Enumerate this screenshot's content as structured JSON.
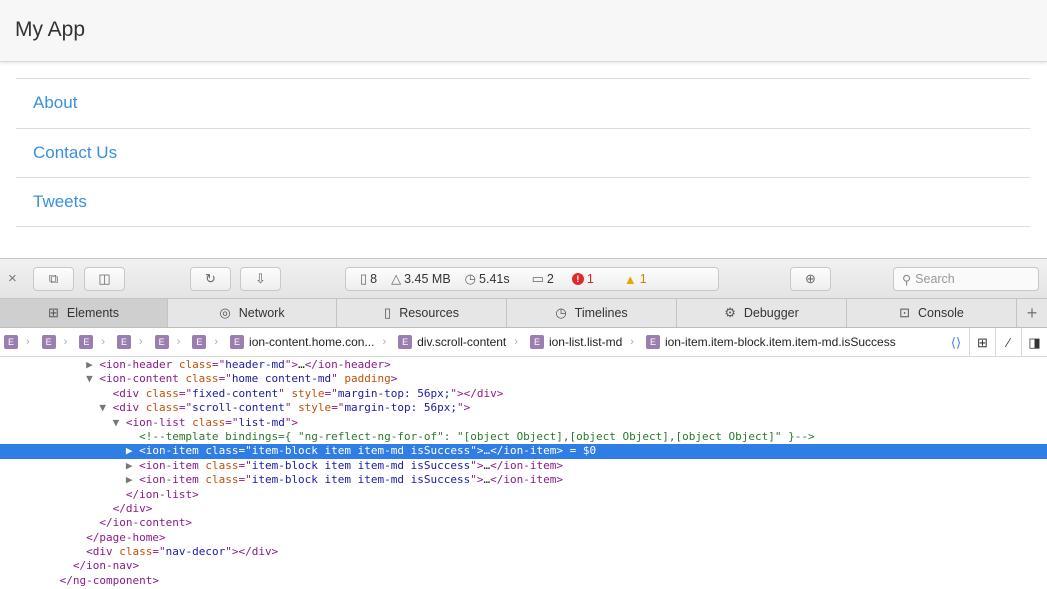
{
  "app": {
    "title": "My App",
    "items": [
      "About",
      "Contact Us",
      "Tweets"
    ]
  },
  "devtools": {
    "toolbar": {
      "close": "×",
      "resources_count": "8",
      "memory": "3.45 MB",
      "time": "5.41s",
      "logs_count": "2",
      "errors_count": "1",
      "warnings_count": "1",
      "search_placeholder": "Search"
    },
    "tabs": [
      {
        "label": "Elements",
        "icon": "elements-icon"
      },
      {
        "label": "Network",
        "icon": "network-icon"
      },
      {
        "label": "Resources",
        "icon": "resources-icon"
      },
      {
        "label": "Timelines",
        "icon": "timelines-icon"
      },
      {
        "label": "Debugger",
        "icon": "debugger-icon"
      },
      {
        "label": "Console",
        "icon": "console-icon"
      }
    ],
    "breadcrumb": {
      "badge": "E",
      "items": [
        "ion-content.home.con...",
        "div.scroll-content",
        "ion-list.list-md",
        "ion-item.item-block.item.item-md.isSuccess"
      ]
    },
    "dom_lines": [
      {
        "indent": 13,
        "tri": "▶ ",
        "parts": [
          [
            "tg",
            "<ion-header "
          ],
          [
            "an",
            "class"
          ],
          [
            "tg",
            "=\""
          ],
          [
            "av",
            "header-md"
          ],
          [
            "tg",
            "\">"
          ],
          [
            "tx",
            "…"
          ],
          [
            "tg",
            "</ion-header>"
          ]
        ]
      },
      {
        "indent": 13,
        "tri": "▼ ",
        "parts": [
          [
            "tg",
            "<ion-content "
          ],
          [
            "an",
            "class"
          ],
          [
            "tg",
            "=\""
          ],
          [
            "av",
            "home content-md"
          ],
          [
            "tg",
            "\" "
          ],
          [
            "an",
            "padding"
          ],
          [
            "tg",
            ">"
          ]
        ]
      },
      {
        "indent": 17,
        "tri": "",
        "parts": [
          [
            "tg",
            "<div "
          ],
          [
            "an",
            "class"
          ],
          [
            "tg",
            "=\""
          ],
          [
            "av",
            "fixed-content"
          ],
          [
            "tg",
            "\" "
          ],
          [
            "an",
            "style"
          ],
          [
            "tg",
            "=\""
          ],
          [
            "av",
            "margin-top: 56px;"
          ],
          [
            "tg",
            "\"></div>"
          ]
        ]
      },
      {
        "indent": 15,
        "tri": "▼ ",
        "parts": [
          [
            "tg",
            "<div "
          ],
          [
            "an",
            "class"
          ],
          [
            "tg",
            "=\""
          ],
          [
            "av",
            "scroll-content"
          ],
          [
            "tg",
            "\" "
          ],
          [
            "an",
            "style"
          ],
          [
            "tg",
            "=\""
          ],
          [
            "av",
            "margin-top: 56px;"
          ],
          [
            "tg",
            "\">"
          ]
        ]
      },
      {
        "indent": 17,
        "tri": "▼ ",
        "parts": [
          [
            "tg",
            "<ion-list "
          ],
          [
            "an",
            "class"
          ],
          [
            "tg",
            "=\""
          ],
          [
            "av",
            "list-md"
          ],
          [
            "tg",
            "\">"
          ]
        ]
      },
      {
        "indent": 21,
        "tri": "",
        "parts": [
          [
            "cm",
            "<!--template bindings={ \"ng-reflect-ng-for-of\": \"[object Object],[object Object],[object Object]\" }-->"
          ]
        ]
      },
      {
        "indent": 19,
        "tri": "▶ ",
        "sel": true,
        "parts": [
          [
            "tg",
            "<ion-item "
          ],
          [
            "an",
            "class"
          ],
          [
            "tg",
            "=\""
          ],
          [
            "av",
            "item-block item item-md isSuccess"
          ],
          [
            "tg",
            "\">"
          ],
          [
            "tx",
            "…"
          ],
          [
            "tg",
            "</ion-item>"
          ],
          [
            "tx",
            " = $0"
          ]
        ]
      },
      {
        "indent": 19,
        "tri": "▶ ",
        "parts": [
          [
            "tg",
            "<ion-item "
          ],
          [
            "an",
            "class"
          ],
          [
            "tg",
            "=\""
          ],
          [
            "av",
            "item-block item item-md isSuccess"
          ],
          [
            "tg",
            "\">"
          ],
          [
            "tx",
            "…"
          ],
          [
            "tg",
            "</ion-item>"
          ]
        ]
      },
      {
        "indent": 19,
        "tri": "▶ ",
        "parts": [
          [
            "tg",
            "<ion-item "
          ],
          [
            "an",
            "class"
          ],
          [
            "tg",
            "=\""
          ],
          [
            "av",
            "item-block item item-md isSuccess"
          ],
          [
            "tg",
            "\">"
          ],
          [
            "tx",
            "…"
          ],
          [
            "tg",
            "</ion-item>"
          ]
        ]
      },
      {
        "indent": 19,
        "tri": "",
        "parts": [
          [
            "tg",
            "</ion-list>"
          ]
        ]
      },
      {
        "indent": 17,
        "tri": "",
        "parts": [
          [
            "tg",
            "</div>"
          ]
        ]
      },
      {
        "indent": 15,
        "tri": "",
        "parts": [
          [
            "tg",
            "</ion-content>"
          ]
        ]
      },
      {
        "indent": 13,
        "tri": "",
        "parts": [
          [
            "tg",
            "</page-home>"
          ]
        ]
      },
      {
        "indent": 13,
        "tri": "",
        "parts": [
          [
            "tg",
            "<div "
          ],
          [
            "an",
            "class"
          ],
          [
            "tg",
            "=\""
          ],
          [
            "av",
            "nav-decor"
          ],
          [
            "tg",
            "\"></div>"
          ]
        ]
      },
      {
        "indent": 11,
        "tri": "",
        "parts": [
          [
            "tg",
            "</ion-nav>"
          ]
        ]
      },
      {
        "indent": 9,
        "tri": "",
        "parts": [
          [
            "tg",
            "</ng-component>"
          ]
        ]
      }
    ]
  }
}
